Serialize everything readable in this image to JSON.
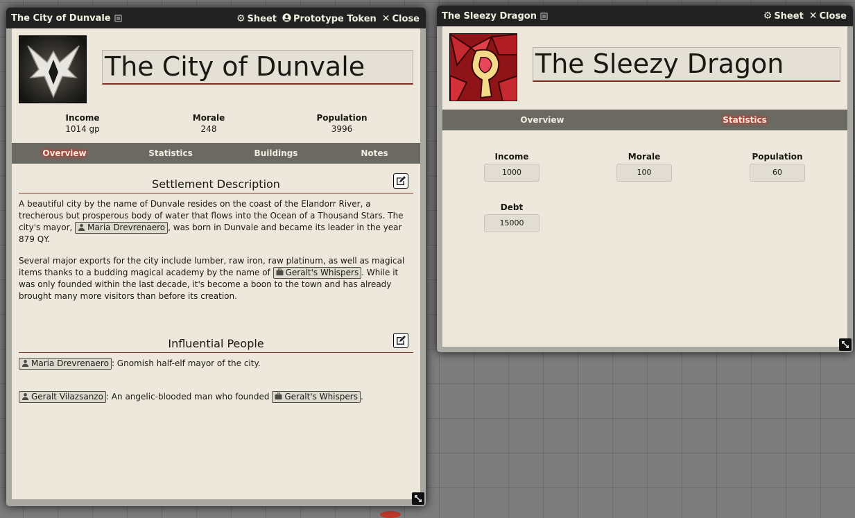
{
  "city_sheet": {
    "window_title": "The City of Dunvale",
    "controls": {
      "sheet": "Sheet",
      "prototype_token": "Prototype Token",
      "close": "Close"
    },
    "name": "The City of Dunvale",
    "stats": [
      {
        "label": "Income",
        "value": "1014 gp"
      },
      {
        "label": "Morale",
        "value": "248"
      },
      {
        "label": "Population",
        "value": "3996"
      }
    ],
    "tabs": [
      "Overview",
      "Statistics",
      "Buildings",
      "Notes"
    ],
    "active_tab": "Overview",
    "sections": {
      "description": {
        "title": "Settlement Description",
        "p1_before": "A beautiful city by the name of Dunvale resides on the coast of the Elandorr River, a trecherous but prosperous body of water that flows into the Ocean of a Thousand Stars. The city's mayor,",
        "p1_link": "Maria Drevrenaero",
        "p1_after": ", was born in Dunvale and became its leader in the year 879 QY.",
        "p2_before": "Several major exports for the city include lumber, raw iron, raw platinum, as well as magical items thanks to a budding magical academy by the name of",
        "p2_link": "Geralt's Whispers",
        "p2_after": ". While it was only founded within the last decade, it's become a boon to the town and has already brought many more visitors than before its creation."
      },
      "people": {
        "title": "Influential People",
        "r1_link": "Maria Drevrenaero",
        "r1_text": ": Gnomish half-elf mayor of the city.",
        "r2_link": "Geralt Vilazsanzo",
        "r2_mid": ": An angelic-blooded man who founded",
        "r2_link2": "Geralt's Whispers",
        "r2_end": "."
      }
    }
  },
  "tavern_sheet": {
    "window_title": "The Sleezy Dragon",
    "controls": {
      "sheet": "Sheet",
      "close": "Close"
    },
    "name": "The Sleezy Dragon",
    "tabs": [
      "Overview",
      "Statistics"
    ],
    "active_tab": "Statistics",
    "stats": [
      {
        "label": "Income",
        "value": "1000"
      },
      {
        "label": "Morale",
        "value": "100"
      },
      {
        "label": "Population",
        "value": "60"
      },
      {
        "label": "Debt",
        "value": "15000"
      }
    ]
  },
  "icons": [
    "gear-icon",
    "user-circle-icon",
    "close-icon",
    "edit-icon",
    "person-icon",
    "briefcase-icon",
    "resize-icon",
    "id-badge-icon"
  ],
  "colors": {
    "header": "#222222",
    "parchment": "#ede7dc",
    "tab_bar": "#6b6a62",
    "accent": "#782e22",
    "active_glow": "#ff3b2f"
  }
}
